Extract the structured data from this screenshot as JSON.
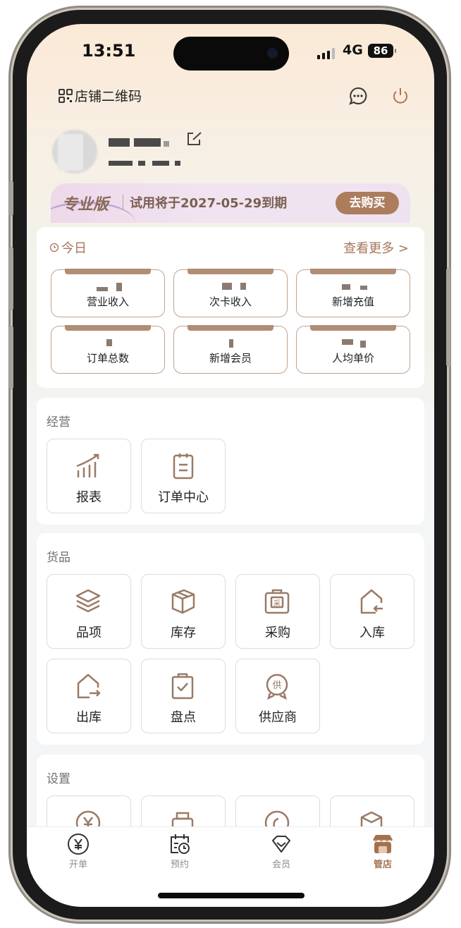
{
  "status_bar": {
    "time": "13:51",
    "network": "4G",
    "battery": "86"
  },
  "header": {
    "qr_label": "店铺二维码"
  },
  "plan": {
    "name": "专业版",
    "expiry": "试用将于2027-05-29到期",
    "buy_label": "去购买"
  },
  "today": {
    "title": "今日",
    "more_label": "查看更多 >",
    "stats": [
      {
        "label": "营业收入"
      },
      {
        "label": "次卡收入"
      },
      {
        "label": "新增充值"
      },
      {
        "label": "订单总数"
      },
      {
        "label": "新增会员"
      },
      {
        "label": "人均单价"
      }
    ]
  },
  "sections": {
    "operation": {
      "title": "经营",
      "items": [
        {
          "label": "报表",
          "icon": "chart-icon"
        },
        {
          "label": "订单中心",
          "icon": "order-icon"
        }
      ]
    },
    "goods": {
      "title": "货品",
      "items": [
        {
          "label": "品项",
          "icon": "layers-icon"
        },
        {
          "label": "库存",
          "icon": "box-icon"
        },
        {
          "label": "采购",
          "icon": "purchase-icon"
        },
        {
          "label": "入库",
          "icon": "stock-in-icon"
        },
        {
          "label": "出库",
          "icon": "stock-out-icon"
        },
        {
          "label": "盘点",
          "icon": "checklist-icon"
        },
        {
          "label": "供应商",
          "icon": "supplier-icon"
        }
      ]
    },
    "settings": {
      "title": "设置"
    }
  },
  "tabs": [
    {
      "label": "开单",
      "icon": "yuan-icon"
    },
    {
      "label": "预约",
      "icon": "calendar-clock-icon"
    },
    {
      "label": "会员",
      "icon": "diamond-icon"
    },
    {
      "label": "管店",
      "icon": "store-icon",
      "active": true
    }
  ],
  "colors": {
    "accent": "#a7765a",
    "button": "#ab7d5d",
    "tab_active": "#a4714f"
  }
}
